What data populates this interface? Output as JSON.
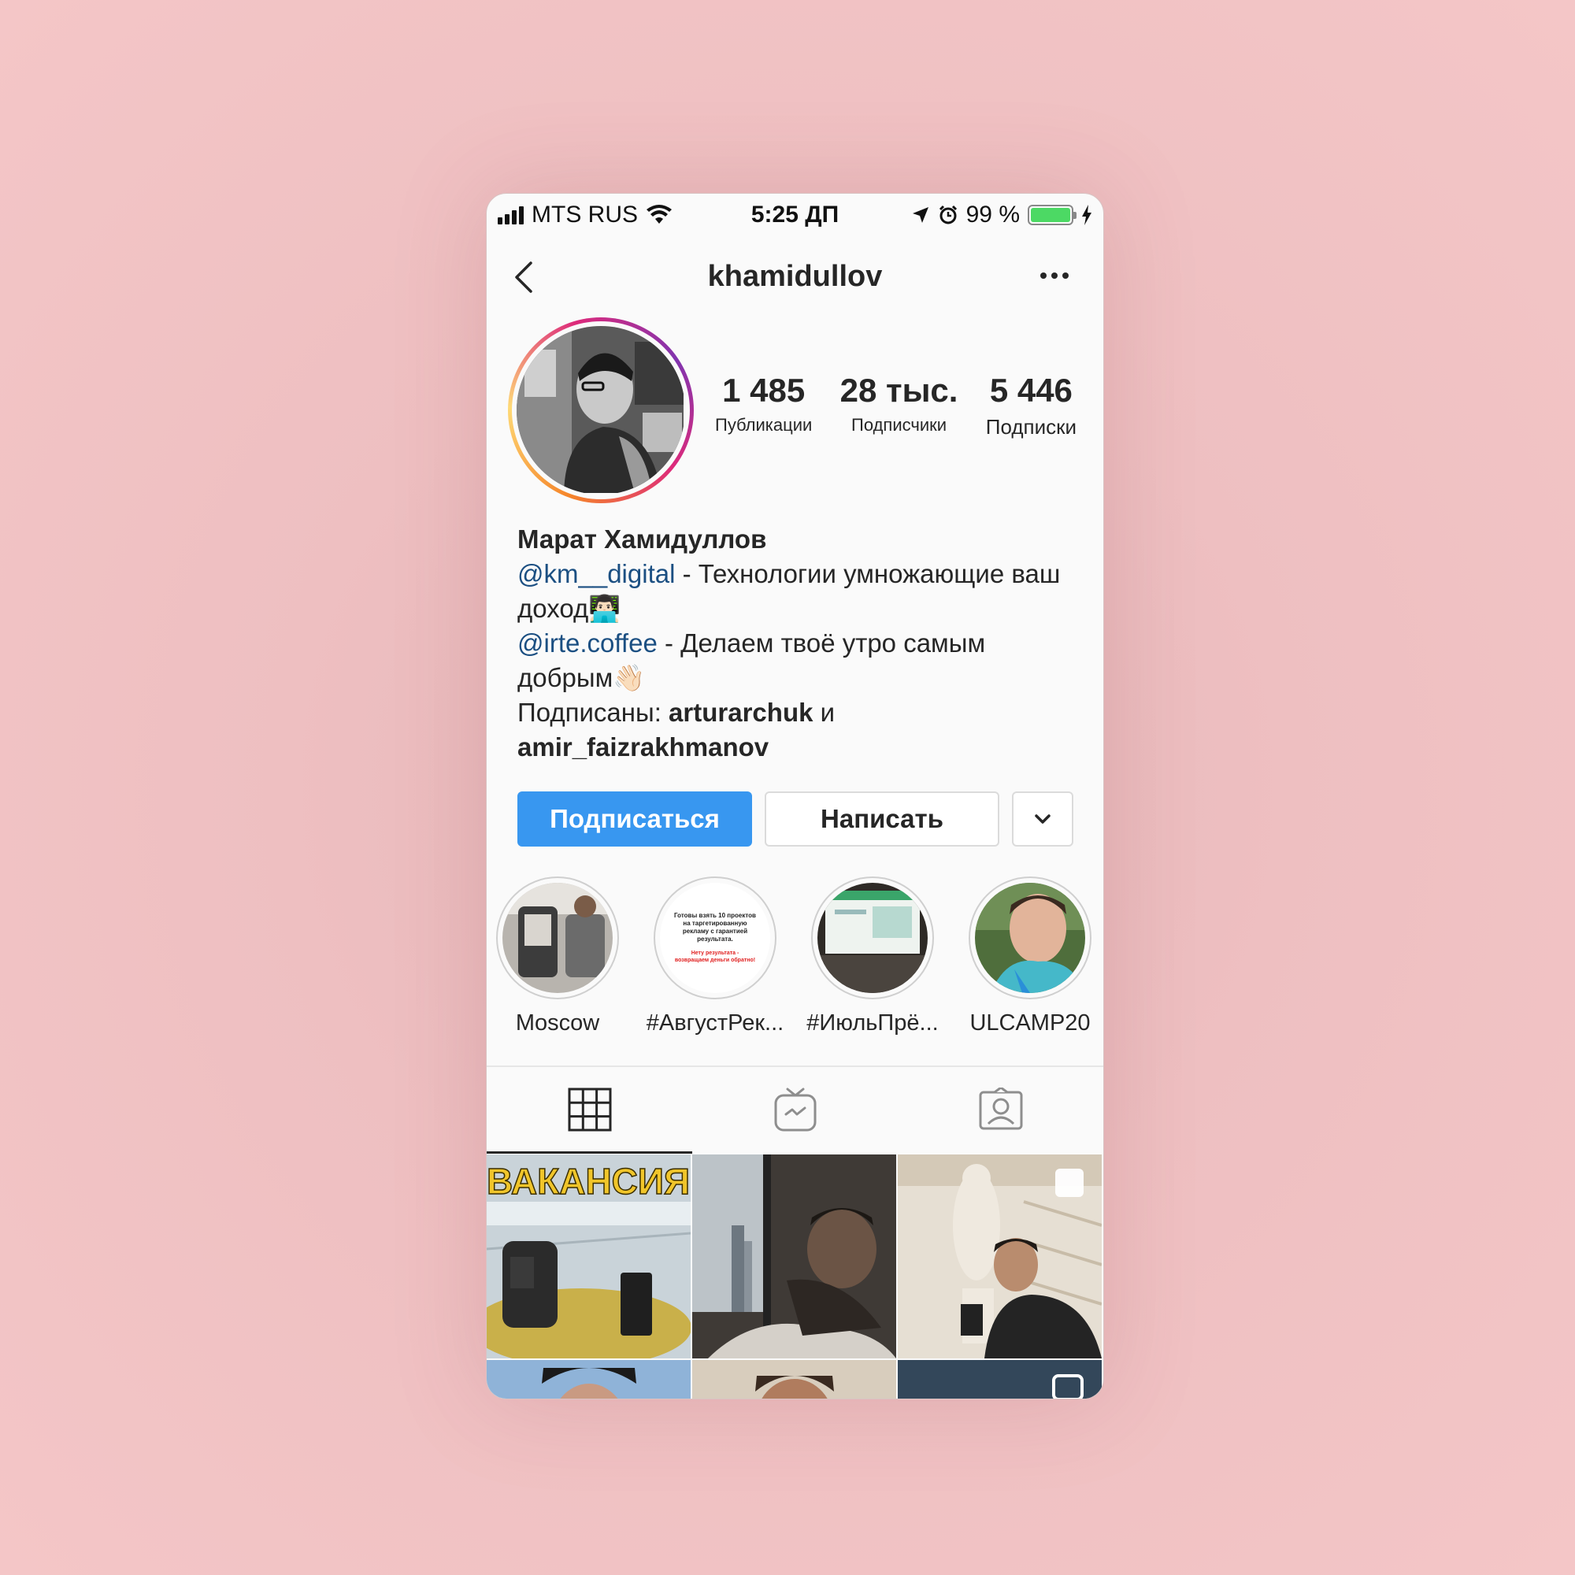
{
  "status_bar": {
    "carrier": "MTS RUS",
    "time": "5:25 ДП",
    "battery": "99 %",
    "battery_level": 0.99
  },
  "nav": {
    "username": "khamidullov",
    "back_icon": "chevron-left-icon",
    "more_icon": "more-horizontal-icon"
  },
  "stats": {
    "posts": {
      "value": "1 485",
      "label": "Публикации"
    },
    "followers": {
      "value": "28 тыс.",
      "label": "Подписчики"
    },
    "following": {
      "value": "5 446",
      "label": "Подписки"
    }
  },
  "bio": {
    "name": "Марат Хамидуллов",
    "mention1": "@km__digital",
    "text1": " - Технологии умножающие ваш доход👨🏻‍💻",
    "mention2": "@irte.coffee",
    "text2": " - Делаем твоё утро самым добрым👋🏻",
    "followed_prefix": "Подписаны: ",
    "followed_user1": "arturarchuk",
    "followed_and": " и ",
    "followed_user2": "amir_faizrakhmanov"
  },
  "buttons": {
    "follow": "Подписаться",
    "message": "Написать",
    "dropdown_icon": "chevron-down-icon"
  },
  "highlights": [
    {
      "label": "Moscow"
    },
    {
      "label": "#АвгустРек..."
    },
    {
      "label": "#ИюльПрё..."
    },
    {
      "label": "ULCAMP20"
    }
  ],
  "highlight_card": {
    "line1": "Готовы взять 10 проектов на таргетированную рекламу с гарантией результата.",
    "line2": "Нету результата - возвращаем деньги обратно!"
  },
  "tabs": [
    {
      "icon": "grid-icon",
      "active": true
    },
    {
      "icon": "igtv-icon",
      "active": false
    },
    {
      "icon": "tagged-icon",
      "active": false
    }
  ],
  "posts": {
    "first_caption": "ВАКАНСИЯ"
  },
  "colors": {
    "accent": "#3897f0",
    "mention": "#1b4f82",
    "background": "#f4c6c7"
  }
}
